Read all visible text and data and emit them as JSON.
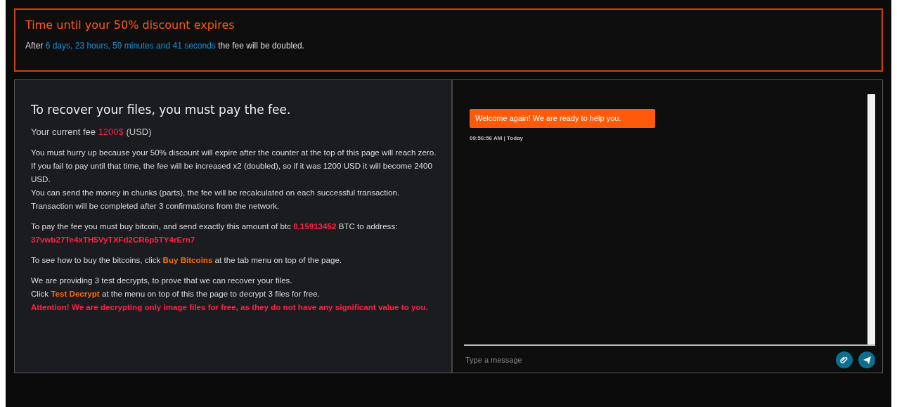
{
  "countdown": {
    "title": "Time until your 50% discount expires",
    "segments": [
      {
        "text": "After ",
        "kind": "plain"
      },
      {
        "text": "6 days, 23 hours, 59 minutes and 41 seconds",
        "kind": "time"
      },
      {
        "text": " the fee will be doubled.",
        "kind": "plain"
      }
    ]
  },
  "instructions": {
    "title": "To recover your files, you must pay the fee.",
    "fee_line": [
      {
        "text": "Your current fee ",
        "kind": "plain"
      },
      {
        "text": "1200$",
        "kind": "amount"
      },
      {
        "text": " (USD)",
        "kind": "plain"
      }
    ],
    "paragraphs": [
      {
        "lines": [
          [
            {
              "text": "You must hurry up because your 50% discount will expire after the counter at the top of this page will reach zero. If you fail to pay until that time, the fee will be increased x2 (doubled), so if it was 1200 USD it will become 2400 USD.",
              "kind": "plain"
            }
          ],
          [
            {
              "text": "You can send the money in chunks (parts), the fee will be recalculated on each successful transaction. Transaction will be completed after 3 confirmations from the network.",
              "kind": "plain"
            }
          ]
        ]
      },
      {
        "lines": [
          [
            {
              "text": "To pay the fee you must buy bitcoin, and send exactly this amount of btc ",
              "kind": "plain"
            },
            {
              "text": "0.15913452",
              "kind": "strong-amount"
            },
            {
              "text": " BTC to address:",
              "kind": "plain"
            }
          ],
          [
            {
              "text": "37vwb27Te4xTH5VyTXFd2CR6p5TY4rErn7",
              "kind": "strong-amount"
            }
          ]
        ]
      },
      {
        "lines": [
          [
            {
              "text": "To see how to buy the bitcoins, click ",
              "kind": "plain"
            },
            {
              "text": "Buy Bitcoins",
              "kind": "link"
            },
            {
              "text": " at the tab menu on top of the page.",
              "kind": "plain"
            }
          ]
        ]
      },
      {
        "lines": [
          [
            {
              "text": "We are providing 3 test decrypts, to prove that we can recover your files.",
              "kind": "plain"
            }
          ],
          [
            {
              "text": "Click ",
              "kind": "plain"
            },
            {
              "text": "Test Decrypt",
              "kind": "link"
            },
            {
              "text": " at the menu on top of this the page to decrypt 3 files for free.",
              "kind": "plain"
            }
          ],
          [
            {
              "text": "Attention! We are decrypting only image files for free, as they do not have any significant value to you.",
              "kind": "warning"
            }
          ]
        ]
      }
    ]
  },
  "chat": {
    "messages": [
      {
        "text": "Welcome again! We are ready to help you.",
        "time": "09:56:56 AM | Today"
      }
    ],
    "input": {
      "placeholder": "Type a message"
    }
  }
}
